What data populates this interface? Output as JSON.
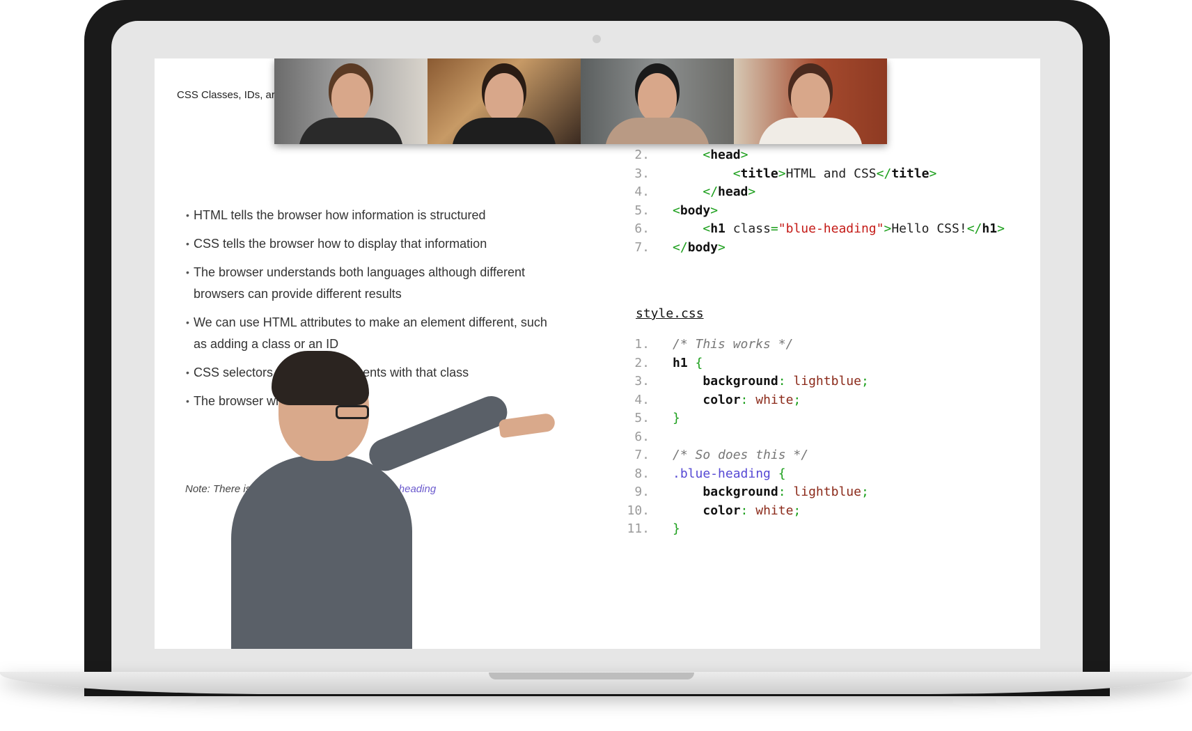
{
  "lesson": {
    "title": "CSS Classes, IDs, ar",
    "bullets": [
      "HTML tells the browser how information is structured",
      "CSS tells the browser how to display that information",
      "The browser understands both languages although different browsers can provide different results",
      "We can use HTML attributes to make an element different, such as adding a class or an ID",
      "CSS selectors can target elements with that class",
      "The browser will co                for us"
    ],
    "note_prefix": "Note: There is no significa",
    "note_code": "lue-heading"
  },
  "html_code": {
    "lines": [
      {
        "n": "2.",
        "indent": "    ",
        "open": "<",
        "tag": "head",
        "close": ">",
        "rest": ""
      },
      {
        "n": "3.",
        "indent": "        ",
        "open": "<",
        "tag": "title",
        "close": ">",
        "rest": "HTML and CSS",
        "end_open": "</",
        "end_tag": "title",
        "end_close": ">"
      },
      {
        "n": "4.",
        "indent": "    ",
        "open": "</",
        "tag": "head",
        "close": ">",
        "rest": ""
      },
      {
        "n": "5.",
        "indent": "",
        "open": "<",
        "tag": "body",
        "close": ">",
        "rest": ""
      },
      {
        "n": "6.",
        "indent": "    ",
        "open": "<",
        "tag": "h1",
        "attr": " class",
        "eq": "=",
        "str": "\"blue-heading\"",
        "close": ">",
        "rest": "Hello CSS!",
        "end_open": "</",
        "end_tag": "h1",
        "end_close": ">"
      },
      {
        "n": "7.",
        "indent": "",
        "open": "</",
        "tag": "body",
        "close": ">",
        "rest": ""
      }
    ]
  },
  "css_file": {
    "name": "style.css",
    "lines": [
      {
        "n": "1.",
        "kind": "comment",
        "text": "/* This works */"
      },
      {
        "n": "2.",
        "kind": "selector-tag",
        "sel": "h1",
        "brace": " {"
      },
      {
        "n": "3.",
        "kind": "decl",
        "prop": "background",
        "colon": ": ",
        "val": "lightblue",
        "semi": ";"
      },
      {
        "n": "4.",
        "kind": "decl",
        "prop": "color",
        "colon": ": ",
        "val": "white",
        "semi": ";"
      },
      {
        "n": "5.",
        "kind": "close",
        "brace": "}"
      },
      {
        "n": "6.",
        "kind": "blank"
      },
      {
        "n": "7.",
        "kind": "comment",
        "text": "/* So does this */"
      },
      {
        "n": "8.",
        "kind": "selector-class",
        "sel": ".blue-heading",
        "brace": " {"
      },
      {
        "n": "9.",
        "kind": "decl",
        "prop": "background",
        "colon": ": ",
        "val": "lightblue",
        "semi": ";"
      },
      {
        "n": "10.",
        "kind": "decl",
        "prop": "color",
        "colon": ": ",
        "val": "white",
        "semi": ";"
      },
      {
        "n": "11.",
        "kind": "close",
        "brace": "}"
      }
    ]
  },
  "video_call": {
    "participants": [
      {
        "shirt": "#2a2a2a",
        "hair": "#5a3a24"
      },
      {
        "shirt": "#1e1e1e",
        "hair": "#2a1c14"
      },
      {
        "shirt": "#b99a84",
        "hair": "#1a1a1a"
      },
      {
        "shirt": "#f0ece6",
        "hair": "#4a2a1e"
      }
    ]
  },
  "colors": {
    "tag": "#1a9e1a",
    "string": "#c41a16",
    "class_selector": "#5548d4",
    "value": "#8b2a1a"
  }
}
